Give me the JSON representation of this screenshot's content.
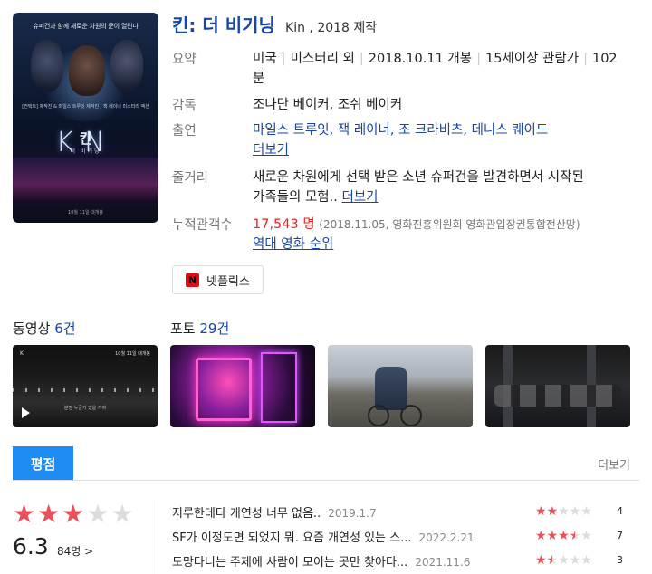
{
  "poster": {
    "tagline": "슈퍼건과 함께 새로운 차원의 문이 열린다",
    "credits": "[컨택트] 제작진 & 마일스 트루잇 제작진 / 잭 레이너 미스터리 액션",
    "logo": "KN",
    "title_ko": "킨",
    "subtitle": "더 비기닝",
    "bottom": "10월 11일 대개봉"
  },
  "title": {
    "main": "킨: 더 비기닝",
    "original": "Kin , 2018 제작"
  },
  "info": {
    "summary_label": "요약",
    "summary": [
      "미국",
      "미스터리 외",
      "2018.10.11 개봉",
      "15세이상 관람가",
      "102"
    ],
    "runtime_unit": "분",
    "director_label": "감독",
    "directors": "조나단 베이커, 조쉬 베이커",
    "cast_label": "출연",
    "cast": "마일스 트루잇, 잭 레이너, 조 크라비츠, 데니스 퀘이드",
    "cast_more": "더보기",
    "plot_label": "줄거리",
    "plot_line1": "새로운 차원에게 선택 받은 소년 슈퍼건을 발견하면서 시작된",
    "plot_line2": "가족들의 모험..",
    "plot_more": "더보기",
    "audience_label": "누적관객수",
    "audience": "17,543 명",
    "audience_note": "(2018.11.05, 영화진흥위원회 영화관입장권통합전산망)",
    "ranking_link": "역대 영화 순위"
  },
  "netflix": {
    "icon_letter": "N",
    "label": "넷플릭스"
  },
  "videos": {
    "label": "동영상",
    "count": "6건",
    "thumb_logo": "K",
    "thumb_tag": "10월 11일 대개봉",
    "thumb_caption": "분명 누군가 있을 거야"
  },
  "photos": {
    "label": "포토",
    "count": "29건"
  },
  "rating": {
    "tab": "평점",
    "more": "더보기",
    "score": "6.3",
    "votes": "84명 >",
    "stars_filled": 3,
    "stars_total": 5,
    "reviews": [
      {
        "text": "지루한데다 개연성 너무 없음..",
        "date": "2019.1.7",
        "score": "4",
        "stars": 2
      },
      {
        "text": "SF가 이정도면 되었지 뭐. 요즘 개연성 있는 스...",
        "date": "2022.2.21",
        "score": "7",
        "stars": 3.5
      },
      {
        "text": "도망다니는 주제에 사람이 모이는 곳만 찾아다...",
        "date": "2021.11.6",
        "score": "3",
        "stars": 1.5
      }
    ]
  },
  "colors": {
    "link": "#1546a8",
    "star": "#e8505a",
    "tab": "#1f8cf4",
    "audience": "#ee2222",
    "netflix": "#e50914"
  }
}
